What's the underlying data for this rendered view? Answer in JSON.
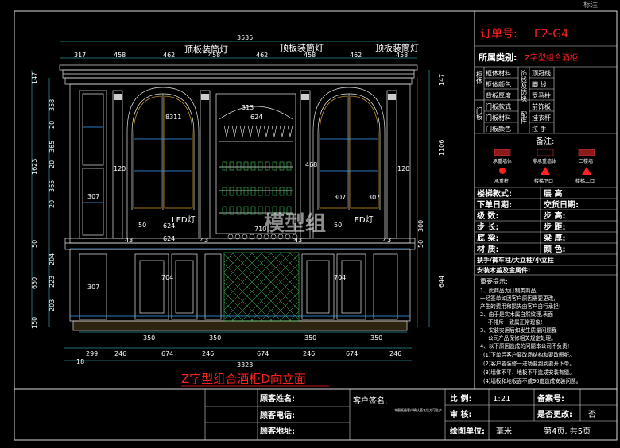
{
  "top_corner": "标注",
  "drawing": {
    "title": "Z字型组合酒柜D向立面",
    "led_top_labels": [
      "顶板装筒灯",
      "顶板装筒灯",
      "顶板装筒灯"
    ],
    "led_mid_labels": [
      "LED灯",
      "LED灯"
    ],
    "watermark": "模型组",
    "dims_top": [
      "3535",
      "317",
      "458",
      "462",
      "458",
      "462",
      "458",
      "462",
      "458"
    ],
    "dims_bottom_row1": [
      "350",
      "350",
      "350",
      "350"
    ],
    "dims_bottom_row2": [
      "299",
      "246",
      "674",
      "246",
      "674",
      "246",
      "674",
      "246"
    ],
    "dims_bottom_total": "3323",
    "dims_bottom_small": "18",
    "dims_left_outer": [
      "147",
      "1623",
      "50",
      "650",
      "150"
    ],
    "dims_left_inner": [
      "358",
      "20",
      "365",
      "20",
      "365",
      "20",
      "204",
      "223",
      "203"
    ],
    "dims_right": [
      "147",
      "1106",
      "300",
      "50",
      "644"
    ],
    "dims_misc": [
      "120",
      "307",
      "307",
      "624",
      "624",
      "624",
      "710",
      "704",
      "704",
      "468",
      "313",
      "8311",
      "43",
      "43",
      "43",
      "43",
      "307",
      "307",
      "120",
      "50",
      "50"
    ]
  },
  "panel": {
    "order_label": "订单号:",
    "order_value": "E2-G4",
    "category_label": "所属类别:",
    "category_value": "Z字型组合酒柜",
    "spec_left_group": "柜体",
    "spec_left_group2": "门板",
    "spec_rows_left": [
      "柜体材料",
      "柜体颜色",
      "背板厚度",
      "门板款式",
      "门板材料",
      "门板颜色"
    ],
    "spec_mid_group": "饰线及饰块",
    "spec_mid_group2": "配件",
    "spec_rows_right": [
      "顶冠线",
      "脚 线",
      "罗马柱",
      "前饰板",
      "挂衣杆",
      "拉 手"
    ],
    "notes_title": "备注:",
    "legend": [
      "承重墙体",
      "非承重墙体",
      "二楼墙",
      "承重柱",
      "楼梯下口",
      "楼梯上口"
    ],
    "info_rows": [
      [
        "楼梯款式:",
        "层 高"
      ],
      [
        "下单日期:",
        "交货日期:"
      ],
      [
        "级 数:",
        "步 高:"
      ],
      [
        "步 长:",
        "步 距:"
      ],
      [
        "底 梁:",
        "梁 厚:"
      ],
      [
        "材 质:",
        "颜 色:"
      ]
    ],
    "extra1": "扶手/裤车柱/大立柱/小立柱",
    "extra2": "安装木盖及金属件:",
    "reminder_title": "重要提示:",
    "reminders": [
      "1、此商品为订制类商品,",
      "一经签单如因客户原因需要更改,",
      "产生的费用和损失由客户自行承担!",
      "2、由于是实木属自然纹理,表面",
      "不排斥一致属正常现象!",
      "3、安装实用后如发生质量问题我",
      "公司产品保修相关规定处理。",
      "4、以下原因造成的问题本公司不负责!",
      "(1)下单后客户要改场结构和要改图纸。",
      "(2)客户要装修一进场要到到要开下单。",
      "(3)墙体不平、地板不平造成安装有缝。",
      "(4)墙板和地板面不成90度造成安装问题。"
    ]
  },
  "titleblock": {
    "client_name": "顾客姓名:",
    "client_phone": "顾客电话:",
    "client_address": "顾客地址:",
    "client_sign": "客户签名:",
    "sign_note": "本图纸经客户确认签名后方可生产",
    "scale_label": "比 例:",
    "scale_value": "1:21",
    "record_label": "备案号:",
    "review_label": "审 核:",
    "changed_label": "是否更改:",
    "changed_value": "否",
    "unit_label": "绘图单位:",
    "unit_value": "毫米",
    "page_label": "第4页, 共5页"
  }
}
